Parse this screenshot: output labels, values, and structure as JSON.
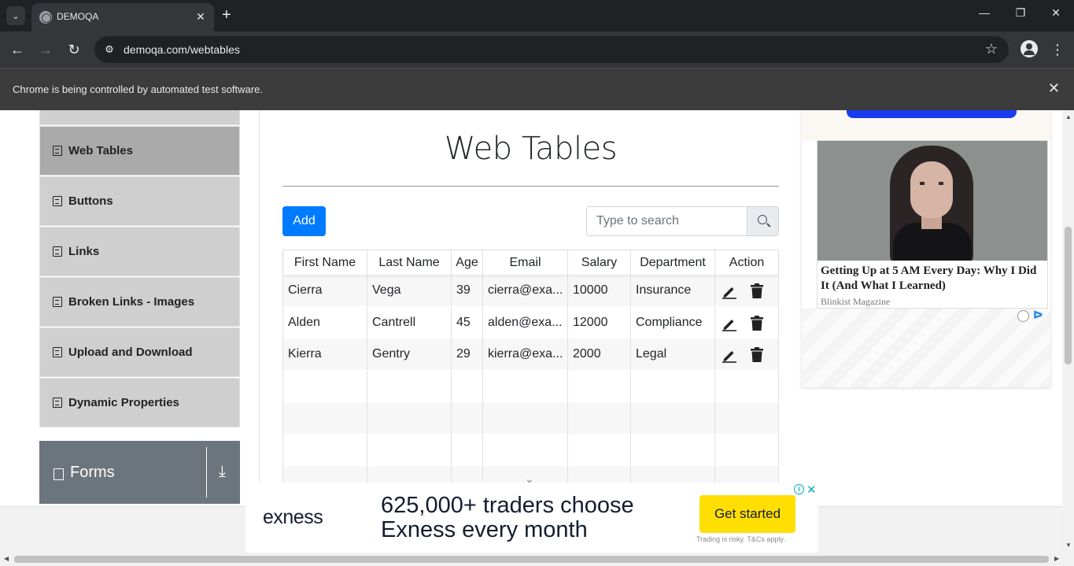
{
  "browser": {
    "tab_title": "DEMOQA",
    "url": "demoqa.com/webtables",
    "infobar_text": "Chrome is being controlled by automated test software."
  },
  "sidebar": {
    "items": [
      {
        "label": "Web Tables",
        "active": true
      },
      {
        "label": "Buttons",
        "active": false
      },
      {
        "label": "Links",
        "active": false
      },
      {
        "label": "Broken Links - Images",
        "active": false
      },
      {
        "label": "Upload and Download",
        "active": false
      },
      {
        "label": "Dynamic Properties",
        "active": false
      }
    ],
    "group": {
      "title": "Forms"
    }
  },
  "main": {
    "title": "Web Tables",
    "add_label": "Add",
    "search_placeholder": "Type to search",
    "columns": [
      "First Name",
      "Last Name",
      "Age",
      "Email",
      "Salary",
      "Department",
      "Action"
    ],
    "rows": [
      [
        "Cierra",
        "Vega",
        "39",
        "cierra@exa...",
        "10000",
        "Insurance"
      ],
      [
        "Alden",
        "Cantrell",
        "45",
        "alden@exa...",
        "12000",
        "Compliance"
      ],
      [
        "Kierra",
        "Gentry",
        "29",
        "kierra@exa...",
        "2000",
        "Legal"
      ]
    ]
  },
  "right_ad": {
    "headline": "Getting Up at 5 AM Every Day: Why I Did It (And What I Learned)",
    "source": "Blinkist Magazine"
  },
  "bottom_ad": {
    "brand": "exness",
    "text": "625,000+ traders choose Exness every month",
    "cta": "Get started",
    "disclaimer": "Trading is risky. T&Cs apply."
  },
  "colors": {
    "accent": "#007bff",
    "sidebar_item": "#cfcfcf",
    "sidebar_active": "#aaaaaa",
    "group_header": "#6c757d",
    "cta": "#ffde02"
  }
}
